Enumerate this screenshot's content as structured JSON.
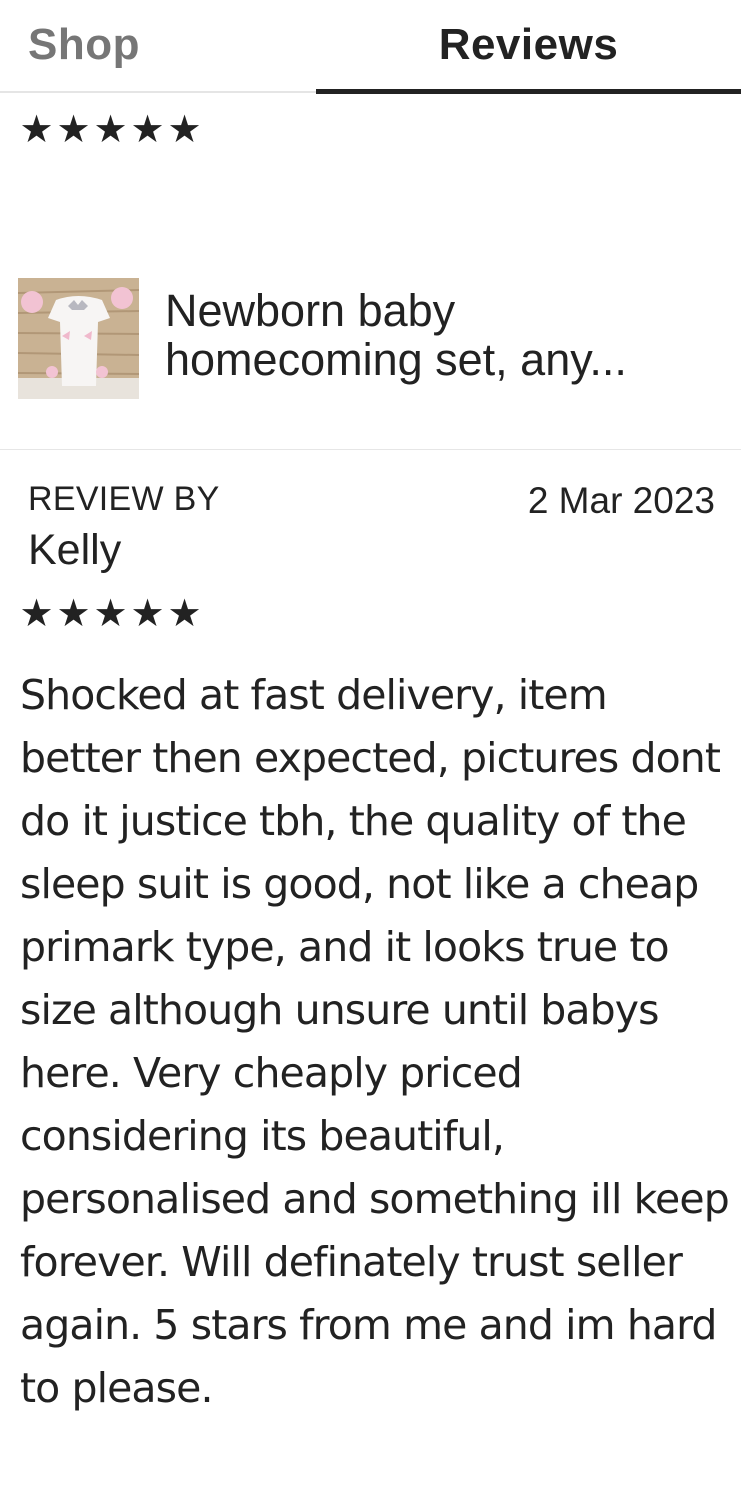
{
  "tabs": [
    {
      "label": "Shop",
      "active": false
    },
    {
      "label": "Reviews",
      "active": true
    }
  ],
  "summary_rating": {
    "stars": 5,
    "max": 5,
    "glyph": "★"
  },
  "product": {
    "title": "Newborn baby homecoming set, any...",
    "thumbnail": "product-thumbnail"
  },
  "review": {
    "by_label": "REVIEW BY",
    "reviewer": "Kelly",
    "date": "2 Mar 2023",
    "rating": {
      "stars": 5,
      "max": 5
    },
    "text": "Shocked at fast delivery, item better then expected, pictures dont do it justice tbh, the quality of the sleep suit is good, not like a cheap primark type, and it looks true to size although unsure until babys here. Very cheaply priced considering its beautiful, personalised and something ill keep forever. Will definately trust seller again. 5 stars from me and im hard to please."
  },
  "colors": {
    "text": "#222222",
    "inactive_tab": "#767676",
    "divider": "#e5e5e5",
    "accent": "#222222"
  }
}
